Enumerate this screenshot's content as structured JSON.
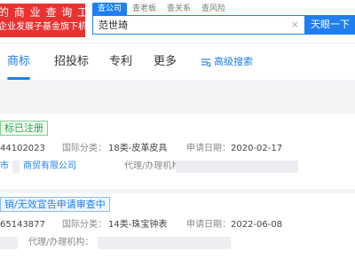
{
  "logo": {
    "line1": "的 商 业 查 询 工 具",
    "line2": "企业发展子基金旗下机构"
  },
  "search": {
    "tabs": [
      "查公司",
      "查老板",
      "查关系",
      "查风险"
    ],
    "query": "范世琦",
    "clear_icon": "×",
    "button_label": "天眼一下"
  },
  "nav": {
    "tabs": [
      "商标",
      "招投标",
      "专利",
      "更多"
    ],
    "advanced_label": "高级搜索"
  },
  "results": [
    {
      "status": "标已注册",
      "reg_no": "44102023",
      "class_label": "国际分类：",
      "class_value": "18类-皮革皮具",
      "date_label": "申请日期：",
      "date_value": "2020-02-17",
      "applicant_a": "市",
      "applicant_b": "商贸有限公司",
      "agent_label": "代理/办理机构："
    },
    {
      "status": "销/无效宣告申请审查中",
      "reg_no": "65143877",
      "class_label": "国际分类：",
      "class_value": "14类-珠宝钟表",
      "date_label": "申请日期：",
      "date_value": "2022-06-08",
      "agent_label": "代理/办理机构："
    }
  ],
  "colors": {
    "primary": "#1f7ff0",
    "brand_red": "#e83333",
    "success": "#2da44e"
  }
}
